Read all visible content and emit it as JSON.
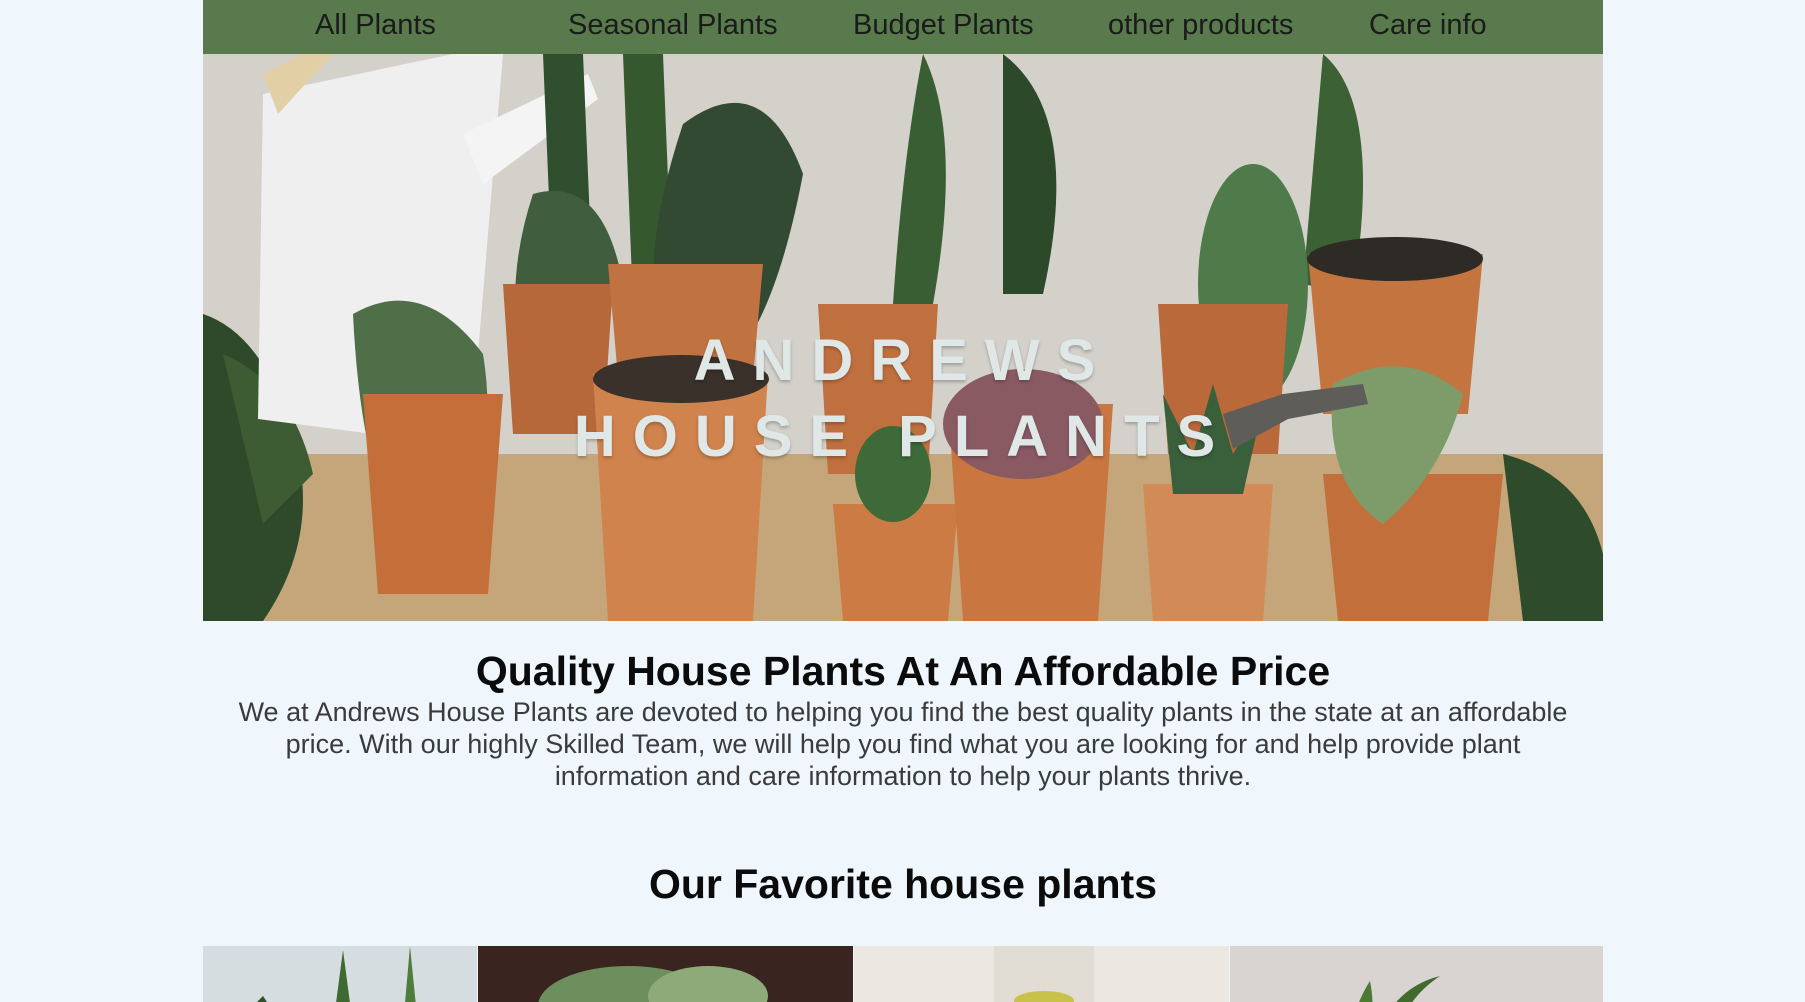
{
  "nav": {
    "items": [
      {
        "label": "All Plants"
      },
      {
        "label": "Seasonal Plants"
      },
      {
        "label": "Budget Plants"
      },
      {
        "label": "other products"
      },
      {
        "label": "Care info"
      }
    ]
  },
  "hero": {
    "title_line1": "ANDREWS",
    "title_line2": "HOUSE PLANTS"
  },
  "intro": {
    "headline": "Quality House Plants At An Affordable Price",
    "body": "We at Andrews House Plants are devoted to helping you find the best quality plants in the state at an affordable price. With our highly Skilled Team, we will help you find what you are looking for and help provide plant information and care information to help your plants thrive."
  },
  "favorites": {
    "title": "Our Favorite house plants"
  },
  "colors": {
    "nav_bg": "#587a4c",
    "page_bg": "#eff7fd",
    "hero_text": "#dfe8e6"
  }
}
